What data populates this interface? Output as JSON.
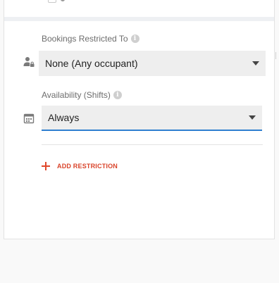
{
  "restriction_field": {
    "label": "Bookings Restricted To",
    "value": "None (Any occupant)"
  },
  "availability_field": {
    "label": "Availability (Shifts)",
    "value": "Always"
  },
  "add_restriction": {
    "label": "ADD RESTRICTION"
  },
  "icons": {
    "restriction": "person-lock-icon",
    "availability": "calendar-icon",
    "info": "info-icon",
    "add": "plus-icon",
    "dropdown": "caret-down-icon"
  },
  "colors": {
    "accent": "#d9432a",
    "focus_underline": "#2f7fd0"
  }
}
